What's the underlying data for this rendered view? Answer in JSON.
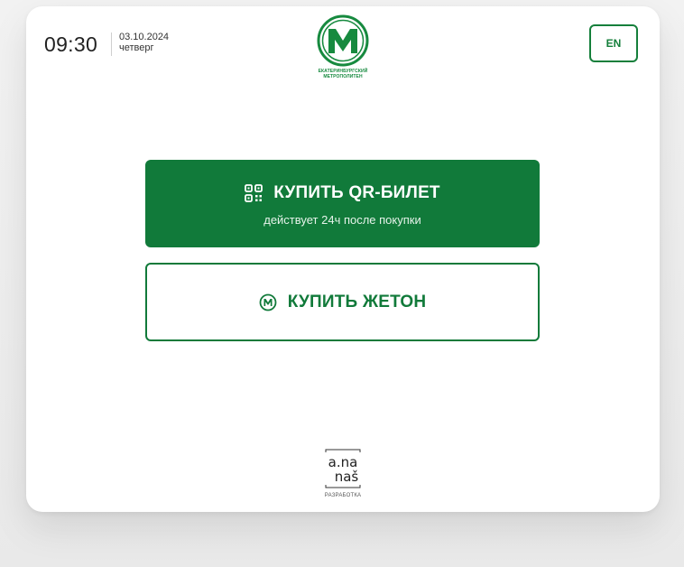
{
  "header": {
    "time": "09:30",
    "date": "03.10.2024",
    "weekday": "четверг",
    "logo": {
      "line1": "ЕКАТЕРИНБУРГСКИЙ",
      "line2": "МЕТРОПОЛИТЕН",
      "icon": "metro-m-logo"
    },
    "language_button": "EN"
  },
  "main": {
    "qr_button": {
      "title": "КУПИТЬ QR-БИЛЕТ",
      "subtitle": "действует 24ч после покупки",
      "icon": "qr-code-icon"
    },
    "token_button": {
      "title": "КУПИТЬ ЖЕТОН",
      "icon": "metro-token-icon"
    }
  },
  "footer": {
    "developer_logo_line1": "a.na",
    "developer_logo_line2": "naš",
    "developer_label": "РАЗРАБОТКА"
  },
  "colors": {
    "primary": "#117a3a",
    "logo_green": "#178a3f",
    "card": "#ffffff",
    "background": "#ececec"
  }
}
